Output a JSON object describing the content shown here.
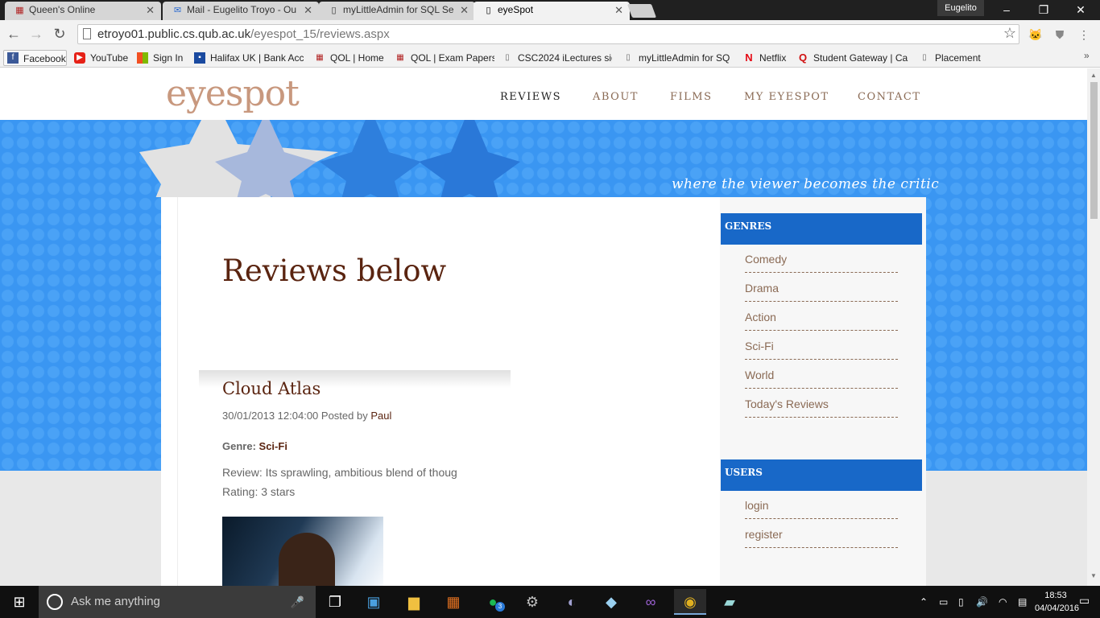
{
  "browser": {
    "tabs": [
      {
        "title": "Queen's Online",
        "icon": "qol-icon",
        "active": false
      },
      {
        "title": "Mail - Eugelito Troyo - Ou",
        "icon": "mail-icon",
        "active": false
      },
      {
        "title": "myLittleAdmin for SQL Se",
        "icon": "page-icon",
        "active": false
      },
      {
        "title": "eyeSpot",
        "icon": "page-icon",
        "active": true
      }
    ],
    "profile_name": "Eugelito",
    "url_host": "etroyo01.public.cs.qub.ac.uk",
    "url_path": "/eyespot_15/reviews.aspx",
    "bookmarks": [
      {
        "label": "Facebook",
        "icon": "facebook-icon"
      },
      {
        "label": "YouTube",
        "icon": "youtube-icon"
      },
      {
        "label": "Sign In",
        "icon": "microsoft-icon"
      },
      {
        "label": "Halifax UK | Bank Acc",
        "icon": "halifax-icon"
      },
      {
        "label": "QOL | Home",
        "icon": "qol-icon"
      },
      {
        "label": "QOL | Exam Papers",
        "icon": "qol-icon"
      },
      {
        "label": "CSC2024 iLectures sig",
        "icon": "page-icon"
      },
      {
        "label": "myLittleAdmin for SQ",
        "icon": "page-icon"
      },
      {
        "label": "Netflix",
        "icon": "netflix-icon"
      },
      {
        "label": "Student Gateway | Ca",
        "icon": "qub-icon"
      },
      {
        "label": "Placement",
        "icon": "page-icon"
      }
    ]
  },
  "site": {
    "logo": "eyespot",
    "nav": [
      "REVIEWS",
      "ABOUT",
      "FILMS",
      "MY EYESPOT",
      "CONTACT"
    ],
    "active_nav": "REVIEWS",
    "tagline": "where the viewer becomes the critic",
    "heading": "Reviews below",
    "review": {
      "title": "Cloud Atlas",
      "date": "30/01/2013 12:04:00",
      "posted_by_label": "Posted by",
      "author": "Paul",
      "genre_label": "Genre:",
      "genre": "Sci-Fi",
      "text": "Review: Its sprawling, ambitious blend of thoug",
      "rating": "Rating: 3 stars"
    },
    "sidebar": {
      "genres_title": "GENRES",
      "genres": [
        "Comedy",
        "Drama",
        "Action",
        "Sci-Fi",
        "World",
        "Today's Reviews"
      ],
      "users_title": "USERS",
      "users": [
        "login",
        "register"
      ]
    }
  },
  "taskbar": {
    "search_placeholder": "Ask me anything",
    "time": "18:53",
    "date": "04/04/2016",
    "spotify_badge": "3"
  },
  "colors": {
    "banner_blue": "#3a96f2",
    "sidebar_header_blue": "#1868c8",
    "heading_brown": "#5a2410",
    "logo_tan": "#c8987e"
  }
}
